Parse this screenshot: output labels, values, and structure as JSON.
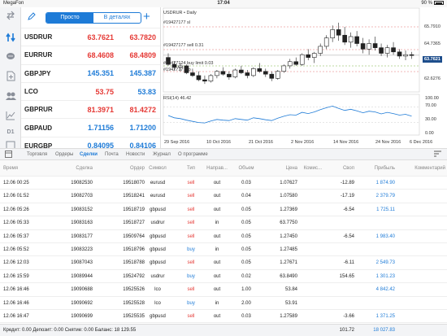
{
  "status": {
    "carrier": "MegaFon",
    "time": "17:04",
    "battery": "90 %"
  },
  "quotes": {
    "seg_simple": "Просто",
    "seg_detail": "В деталях",
    "rows": [
      {
        "symbol": "USDRUR",
        "bid": "63.7621",
        "ask": "63.7820",
        "bid_color": "red",
        "ask_color": "red"
      },
      {
        "symbol": "EURRUR",
        "bid": "68.4608",
        "ask": "68.4809",
        "bid_color": "red",
        "ask_color": "red"
      },
      {
        "symbol": "GBPJPY",
        "bid": "145.351",
        "ask": "145.387",
        "bid_color": "blue",
        "ask_color": "blue"
      },
      {
        "symbol": "LCO",
        "bid": "53.75",
        "ask": "53.83",
        "bid_color": "red",
        "ask_color": "blue"
      },
      {
        "symbol": "GBPRUR",
        "bid": "81.3971",
        "ask": "81.4272",
        "bid_color": "red",
        "ask_color": "red"
      },
      {
        "symbol": "GBPAUD",
        "bid": "1.71156",
        "ask": "1.71200",
        "bid_color": "blue",
        "ask_color": "blue"
      },
      {
        "symbol": "EURGBP",
        "bid": "0.84095",
        "ask": "0.84106",
        "bid_color": "blue",
        "ask_color": "blue"
      }
    ]
  },
  "rail": {
    "timeframe": "D1"
  },
  "chart": {
    "title": "USDRUR • Daily",
    "lines": {
      "sl": "#19427177 sl",
      "sell": "#19427177 sell 0.31",
      "buy_limit": "#19427124 buy limit 0.03",
      "tp": "#19427177 tp"
    },
    "price_labels": [
      "65.7910",
      "64.7365",
      "63.7621",
      "62.6276"
    ],
    "current_price": "63.7621",
    "rsi_label": "RSI(14) 46.42",
    "rsi_labels": [
      "100.00",
      "70.00",
      "30.00",
      "0.00"
    ],
    "date_labels": [
      "29 Sep 2016",
      "10 Oct 2016",
      "21 Oct 2016",
      "2 Nov 2016",
      "14 Nov 2016",
      "24 Nov 2016",
      "6 Dec 2016"
    ],
    "colors": {
      "current_tag": "#1e4e8c",
      "rsi_line": "#1e7bd7",
      "order_line": "#b9b9b9"
    }
  },
  "chart_data": {
    "type": "candlestick",
    "series": [
      {
        "name": "USDRUR",
        "ohlc": [
          [
            63.6,
            63.9,
            63.0,
            63.1
          ],
          [
            63.1,
            63.3,
            62.7,
            62.9
          ],
          [
            62.9,
            63.2,
            62.6,
            63.0
          ],
          [
            63.0,
            63.1,
            62.4,
            62.5
          ],
          [
            62.5,
            62.8,
            62.2,
            62.3
          ],
          [
            62.3,
            62.6,
            61.9,
            62.0
          ],
          [
            62.0,
            62.3,
            61.7,
            61.9
          ],
          [
            61.9,
            62.4,
            61.8,
            62.3
          ],
          [
            62.3,
            62.7,
            62.1,
            62.6
          ],
          [
            62.6,
            62.9,
            62.3,
            62.4
          ],
          [
            62.4,
            62.6,
            62.0,
            62.2
          ],
          [
            62.2,
            62.8,
            62.1,
            62.7
          ],
          [
            62.7,
            63.0,
            62.4,
            62.5
          ],
          [
            62.5,
            62.7,
            62.1,
            62.3
          ],
          [
            62.3,
            62.9,
            62.2,
            62.8
          ],
          [
            62.8,
            63.2,
            62.5,
            62.6
          ],
          [
            62.6,
            62.8,
            62.2,
            62.4
          ],
          [
            62.4,
            62.6,
            61.9,
            62.1
          ],
          [
            62.1,
            62.7,
            62.0,
            62.6
          ],
          [
            62.6,
            63.1,
            62.5,
            63.0
          ],
          [
            63.0,
            63.5,
            62.8,
            63.3
          ],
          [
            63.3,
            63.6,
            63.0,
            63.1
          ],
          [
            63.1,
            63.9,
            63.0,
            63.8
          ],
          [
            63.8,
            64.2,
            63.4,
            63.6
          ],
          [
            63.6,
            64.0,
            63.2,
            63.9
          ],
          [
            63.9,
            64.6,
            63.7,
            64.4
          ],
          [
            64.4,
            65.2,
            64.2,
            65.0
          ],
          [
            65.0,
            65.9,
            64.7,
            65.6
          ],
          [
            65.6,
            66.1,
            64.8,
            65.2
          ],
          [
            65.2,
            65.8,
            64.5,
            64.7
          ],
          [
            64.7,
            65.4,
            64.3,
            65.1
          ],
          [
            65.1,
            65.5,
            64.4,
            64.6
          ],
          [
            64.6,
            65.0,
            63.9,
            64.2
          ],
          [
            64.2,
            64.9,
            63.8,
            64.6
          ],
          [
            64.6,
            65.1,
            64.1,
            64.3
          ],
          [
            64.3,
            64.6,
            63.7,
            63.9
          ],
          [
            63.9,
            64.5,
            63.6,
            64.3
          ],
          [
            64.3,
            64.7,
            63.8,
            64.0
          ],
          [
            64.0,
            64.2,
            63.5,
            63.7
          ],
          [
            63.7,
            64.1,
            63.4,
            63.8
          ],
          [
            63.8,
            64.0,
            63.5,
            63.76
          ]
        ]
      }
    ],
    "rsi": [
      48,
      42,
      40,
      36,
      33,
      30,
      29,
      34,
      38,
      36,
      35,
      40,
      38,
      36,
      42,
      40,
      37,
      35,
      41,
      46,
      50,
      49,
      56,
      53,
      57,
      63,
      68,
      72,
      66,
      61,
      64,
      60,
      55,
      59,
      57,
      52,
      56,
      53,
      49,
      51,
      46.42
    ],
    "x_ticks": [
      "29 Sep 2016",
      "10 Oct 2016",
      "21 Oct 2016",
      "2 Nov 2016",
      "14 Nov 2016",
      "24 Nov 2016",
      "6 Dec 2016"
    ],
    "y_ticks": [
      "65.7910",
      "64.7365",
      "63.7621",
      "62.6276"
    ],
    "ylim": [
      61.3,
      66.5
    ],
    "rsi_ylim": [
      0,
      100
    ]
  },
  "tabs": {
    "items": [
      "Торговля",
      "Ордеры",
      "Сделки",
      "Почта",
      "Новости",
      "Журнал",
      "О программе"
    ],
    "active_index": 2
  },
  "table": {
    "headers": {
      "time": "Время",
      "deal": "Сделка",
      "order": "Ордер",
      "symbol": "Символ",
      "type": "Тип",
      "direction": "Направ...",
      "volume": "Объем",
      "price": "Цена",
      "commission": "Комис...",
      "swap": "Своп",
      "profit": "Прибыль",
      "comment": "Комментарий"
    },
    "rows": [
      {
        "time": "12.06 00:25",
        "deal": "19082530",
        "order": "19518070",
        "symbol": "eurusd",
        "type": "sell",
        "dir": "out",
        "vol": "0.03",
        "price": "1.07627",
        "comm": "",
        "swap": "-12.89",
        "profit": "1 874.90"
      },
      {
        "time": "12.06 01:52",
        "deal": "19082703",
        "order": "19518241",
        "symbol": "eurusd",
        "type": "sell",
        "dir": "out",
        "vol": "0.04",
        "price": "1.07580",
        "comm": "",
        "swap": "-17.19",
        "profit": "2 379.79"
      },
      {
        "time": "12.06 05:26",
        "deal": "19083152",
        "order": "19518719",
        "symbol": "gbpusd",
        "type": "sell",
        "dir": "out",
        "vol": "0.05",
        "price": "1.27369",
        "comm": "",
        "swap": "-6.54",
        "profit": "1 725.11"
      },
      {
        "time": "12.06 05:33",
        "deal": "19083163",
        "order": "19518727",
        "symbol": "usdrur",
        "type": "sell",
        "dir": "in",
        "vol": "0.05",
        "price": "63.7750",
        "comm": "",
        "swap": "",
        "profit": ""
      },
      {
        "time": "12.06 05:37",
        "deal": "19083177",
        "order": "19509764",
        "symbol": "gbpusd",
        "type": "sell",
        "dir": "out",
        "vol": "0.05",
        "price": "1.27450",
        "comm": "",
        "swap": "-6.54",
        "profit": "1 983.40"
      },
      {
        "time": "12.06 05:52",
        "deal": "19083223",
        "order": "19518796",
        "symbol": "gbpusd",
        "type": "buy",
        "dir": "in",
        "vol": "0.05",
        "price": "1.27485",
        "comm": "",
        "swap": "",
        "profit": ""
      },
      {
        "time": "12.06 12:03",
        "deal": "19087043",
        "order": "19518788",
        "symbol": "gbpusd",
        "type": "sell",
        "dir": "out",
        "vol": "0.05",
        "price": "1.27671",
        "comm": "",
        "swap": "-6.11",
        "profit": "2 549.73"
      },
      {
        "time": "12.06 15:59",
        "deal": "19089944",
        "order": "19524792",
        "symbol": "usdrur",
        "type": "buy",
        "dir": "out",
        "vol": "0.02",
        "price": "63.8490",
        "comm": "",
        "swap": "154.65",
        "profit": "1 301.23"
      },
      {
        "time": "12.06 16:46",
        "deal": "19090688",
        "order": "19525526",
        "symbol": "lco",
        "type": "sell",
        "dir": "out",
        "vol": "1.00",
        "price": "53.84",
        "comm": "",
        "swap": "",
        "profit": "4 842.42"
      },
      {
        "time": "12.06 16:46",
        "deal": "19090692",
        "order": "19525528",
        "symbol": "lco",
        "type": "buy",
        "dir": "in",
        "vol": "2.00",
        "price": "53.91",
        "comm": "",
        "swap": "",
        "profit": ""
      },
      {
        "time": "12.06 16:47",
        "deal": "19090699",
        "order": "19525535",
        "symbol": "gbpusd",
        "type": "sell",
        "dir": "out",
        "vol": "0.03",
        "price": "1.27589",
        "comm": "",
        "swap": "-3.66",
        "profit": "1 371.25"
      }
    ]
  },
  "summary": {
    "text": "Кредит: 0.00 Депозит: 0.00 Снятие: 0.00 Баланс: 18 129.55",
    "swap": "101.72",
    "profit": "18 027.83"
  }
}
